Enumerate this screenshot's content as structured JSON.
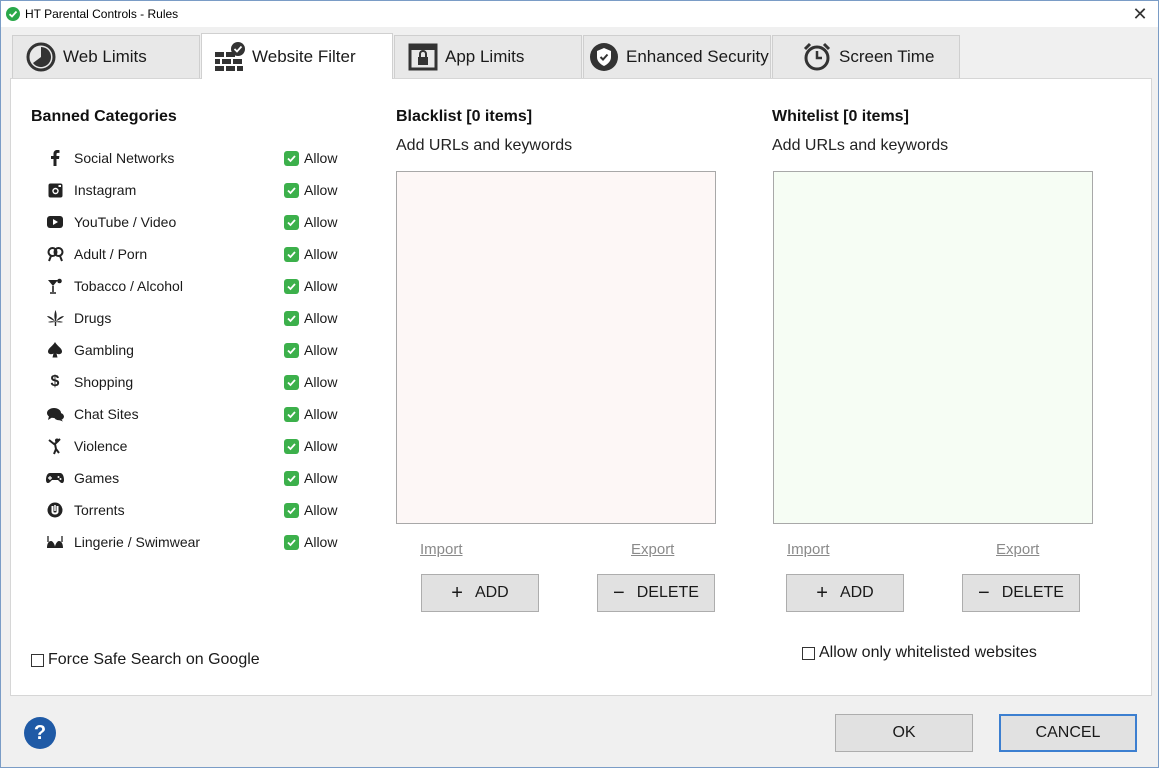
{
  "window": {
    "title": "HT Parental Controls - Rules"
  },
  "tabs": [
    {
      "label": "Web Limits",
      "icon": "pie-clock-icon",
      "active": false
    },
    {
      "label": "Website Filter",
      "icon": "firewall-check-icon",
      "active": true
    },
    {
      "label": "App Limits",
      "icon": "app-lock-icon",
      "active": false
    },
    {
      "label": "Enhanced Security",
      "icon": "shield-check-icon",
      "active": false
    },
    {
      "label": "Screen Time",
      "icon": "alarm-clock-icon",
      "active": false
    }
  ],
  "categories": {
    "title": "Banned Categories",
    "items": [
      {
        "label": "Social Networks",
        "status": "Allow",
        "icon": "facebook-icon"
      },
      {
        "label": "Instagram",
        "status": "Allow",
        "icon": "instagram-icon"
      },
      {
        "label": "YouTube / Video",
        "status": "Allow",
        "icon": "youtube-icon"
      },
      {
        "label": "Adult / Porn",
        "status": "Allow",
        "icon": "adult-icon"
      },
      {
        "label": "Tobacco / Alcohol",
        "status": "Allow",
        "icon": "cocktail-icon"
      },
      {
        "label": "Drugs",
        "status": "Allow",
        "icon": "cannabis-leaf-icon"
      },
      {
        "label": "Gambling",
        "status": "Allow",
        "icon": "spade-icon"
      },
      {
        "label": "Shopping",
        "status": "Allow",
        "icon": "dollar-icon"
      },
      {
        "label": "Chat Sites",
        "status": "Allow",
        "icon": "chat-bubbles-icon"
      },
      {
        "label": "Violence",
        "status": "Allow",
        "icon": "kick-figure-icon"
      },
      {
        "label": "Games",
        "status": "Allow",
        "icon": "gamepad-icon"
      },
      {
        "label": "Torrents",
        "status": "Allow",
        "icon": "torrent-icon"
      },
      {
        "label": "Lingerie / Swimwear",
        "status": "Allow",
        "icon": "bra-icon"
      }
    ],
    "force_safe_search": {
      "label": "Force Safe Search on Google",
      "checked": false
    }
  },
  "blacklist": {
    "title": "Blacklist [0 items]",
    "subtitle": "Add URLs and keywords",
    "bg_color": "#fdf7f6",
    "import_label": "Import",
    "export_label": "Export",
    "add_label": "ADD",
    "delete_label": "DELETE"
  },
  "whitelist": {
    "title": "Whitelist [0 items]",
    "subtitle": "Add URLs and keywords",
    "bg_color": "#f6fdf4",
    "import_label": "Import",
    "export_label": "Export",
    "add_label": "ADD",
    "delete_label": "DELETE",
    "only_whitelisted": {
      "label": "Allow only whitelisted websites",
      "checked": false
    }
  },
  "footer": {
    "help_label": "?",
    "ok_label": "OK",
    "cancel_label": "CANCEL"
  },
  "colors": {
    "accent": "#3c7fd0",
    "allow_green": "#3cb04b",
    "help_blue": "#1f5aa6"
  }
}
